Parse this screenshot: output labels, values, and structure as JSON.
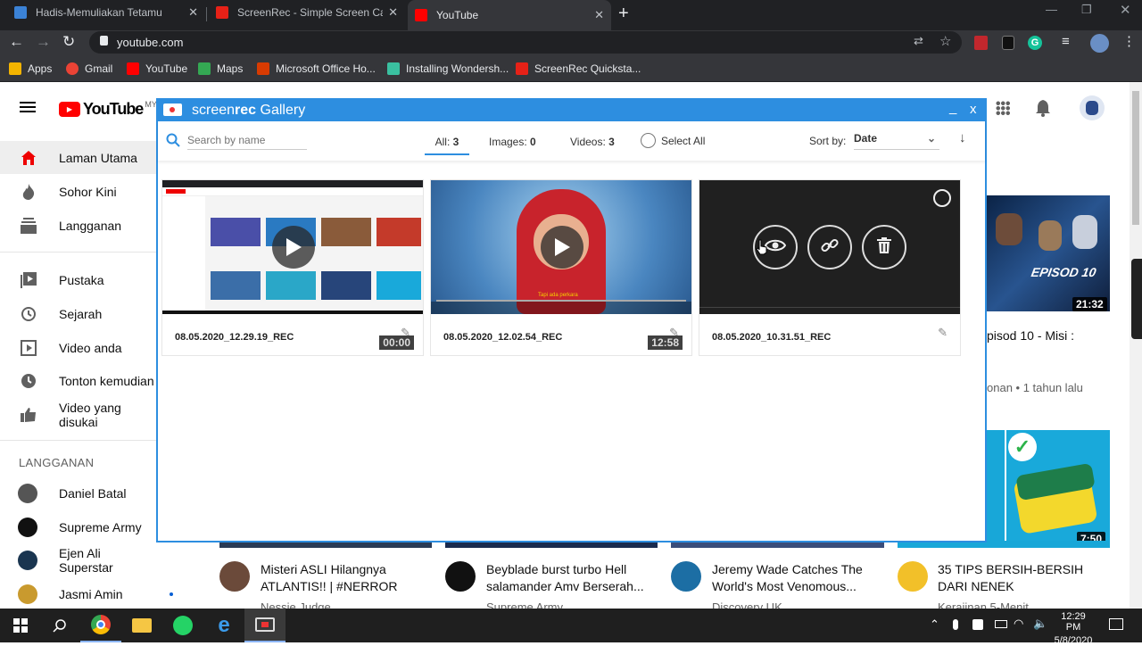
{
  "browser": {
    "tabs": [
      {
        "title": "Hadis-Memuliakan Tetamu",
        "fav_color": "#3b82d6"
      },
      {
        "title": "ScreenRec - Simple Screen Captu",
        "fav_color": "#e62117"
      },
      {
        "title": "YouTube",
        "fav_color": "#ff0000"
      }
    ],
    "url": "youtube.com",
    "bookmarks": [
      {
        "label": "Apps",
        "color": "#f4b400"
      },
      {
        "label": "Gmail",
        "color": "#ea4335"
      },
      {
        "label": "YouTube",
        "color": "#ff0000"
      },
      {
        "label": "Maps",
        "color": "#34a853"
      },
      {
        "label": "Microsoft Office Ho...",
        "color": "#d83b01"
      },
      {
        "label": "Installing Wondersh...",
        "color": "#3ac0a0"
      },
      {
        "label": "ScreenRec Quicksta...",
        "color": "#e62117"
      }
    ]
  },
  "youtube": {
    "logo": "YouTube",
    "region": "MY",
    "sidebar": [
      {
        "label": "Laman Utama",
        "icon": "home-icon"
      },
      {
        "label": "Sohor Kini",
        "icon": "fire-icon"
      },
      {
        "label": "Langganan",
        "icon": "subscriptions-icon"
      },
      {
        "label": "Pustaka",
        "icon": "library-icon"
      },
      {
        "label": "Sejarah",
        "icon": "history-icon"
      },
      {
        "label": "Video anda",
        "icon": "your-videos-icon"
      },
      {
        "label": "Tonton kemudian",
        "icon": "watch-later-icon"
      },
      {
        "label": "Video yang disukai",
        "icon": "like-icon"
      }
    ],
    "subs_heading": "LANGGANAN",
    "subscriptions": [
      {
        "name": "Daniel Batal",
        "color": "#555"
      },
      {
        "name": "Supreme Army",
        "color": "#111"
      },
      {
        "name": "Ejen Ali Superstar",
        "color": "#1a3550"
      },
      {
        "name": "Jasmi Amin",
        "color": "#c99a2e"
      }
    ],
    "right_video": {
      "title_partial": "pisod 10 - Misi :",
      "meta_partial": "onan • 1 tahun lalu",
      "duration": "21:32",
      "thumb_text": "EPISOD 10"
    },
    "right_video2": {
      "duration": "7:50"
    },
    "bottom_videos": [
      {
        "title": "Misteri ASLI Hilangnya ATLANTIS!! | #NERROR",
        "channel": "Nessie Judge",
        "av": "#6b4a3a"
      },
      {
        "title": "Beyblade burst turbo Hell salamander Amv Berserah...",
        "channel": "Supreme Army",
        "av": "#111"
      },
      {
        "title": "Jeremy Wade Catches The World's Most Venomous...",
        "channel": "Discovery UK",
        "av": "#1c6ea4"
      },
      {
        "title": "35 TIPS BERSIH-BERSIH DARI NENEK",
        "channel": "Kerajinan 5-Menit",
        "av": "#f2c029"
      }
    ]
  },
  "screenrec": {
    "title_pre": "screen",
    "title_bold": "rec",
    "title_post": " Gallery",
    "search_placeholder": "Search by name",
    "filters": {
      "all_label": "All:",
      "all_count": "3",
      "images_label": "Images:",
      "images_count": "0",
      "videos_label": "Videos:",
      "videos_count": "3"
    },
    "select_all": "Select All",
    "sort_label": "Sort by:",
    "sort_value": "Date",
    "items": [
      {
        "name": "08.05.2020_12.29.19_REC",
        "duration": "00:00"
      },
      {
        "name": "08.05.2020_12.02.54_REC",
        "duration": "12:58",
        "subtitle": "Tapi ada perkara"
      },
      {
        "name": "08.05.2020_10.31.51_REC"
      }
    ]
  },
  "taskbar": {
    "time": "12:29 PM",
    "date": "5/8/2020"
  }
}
